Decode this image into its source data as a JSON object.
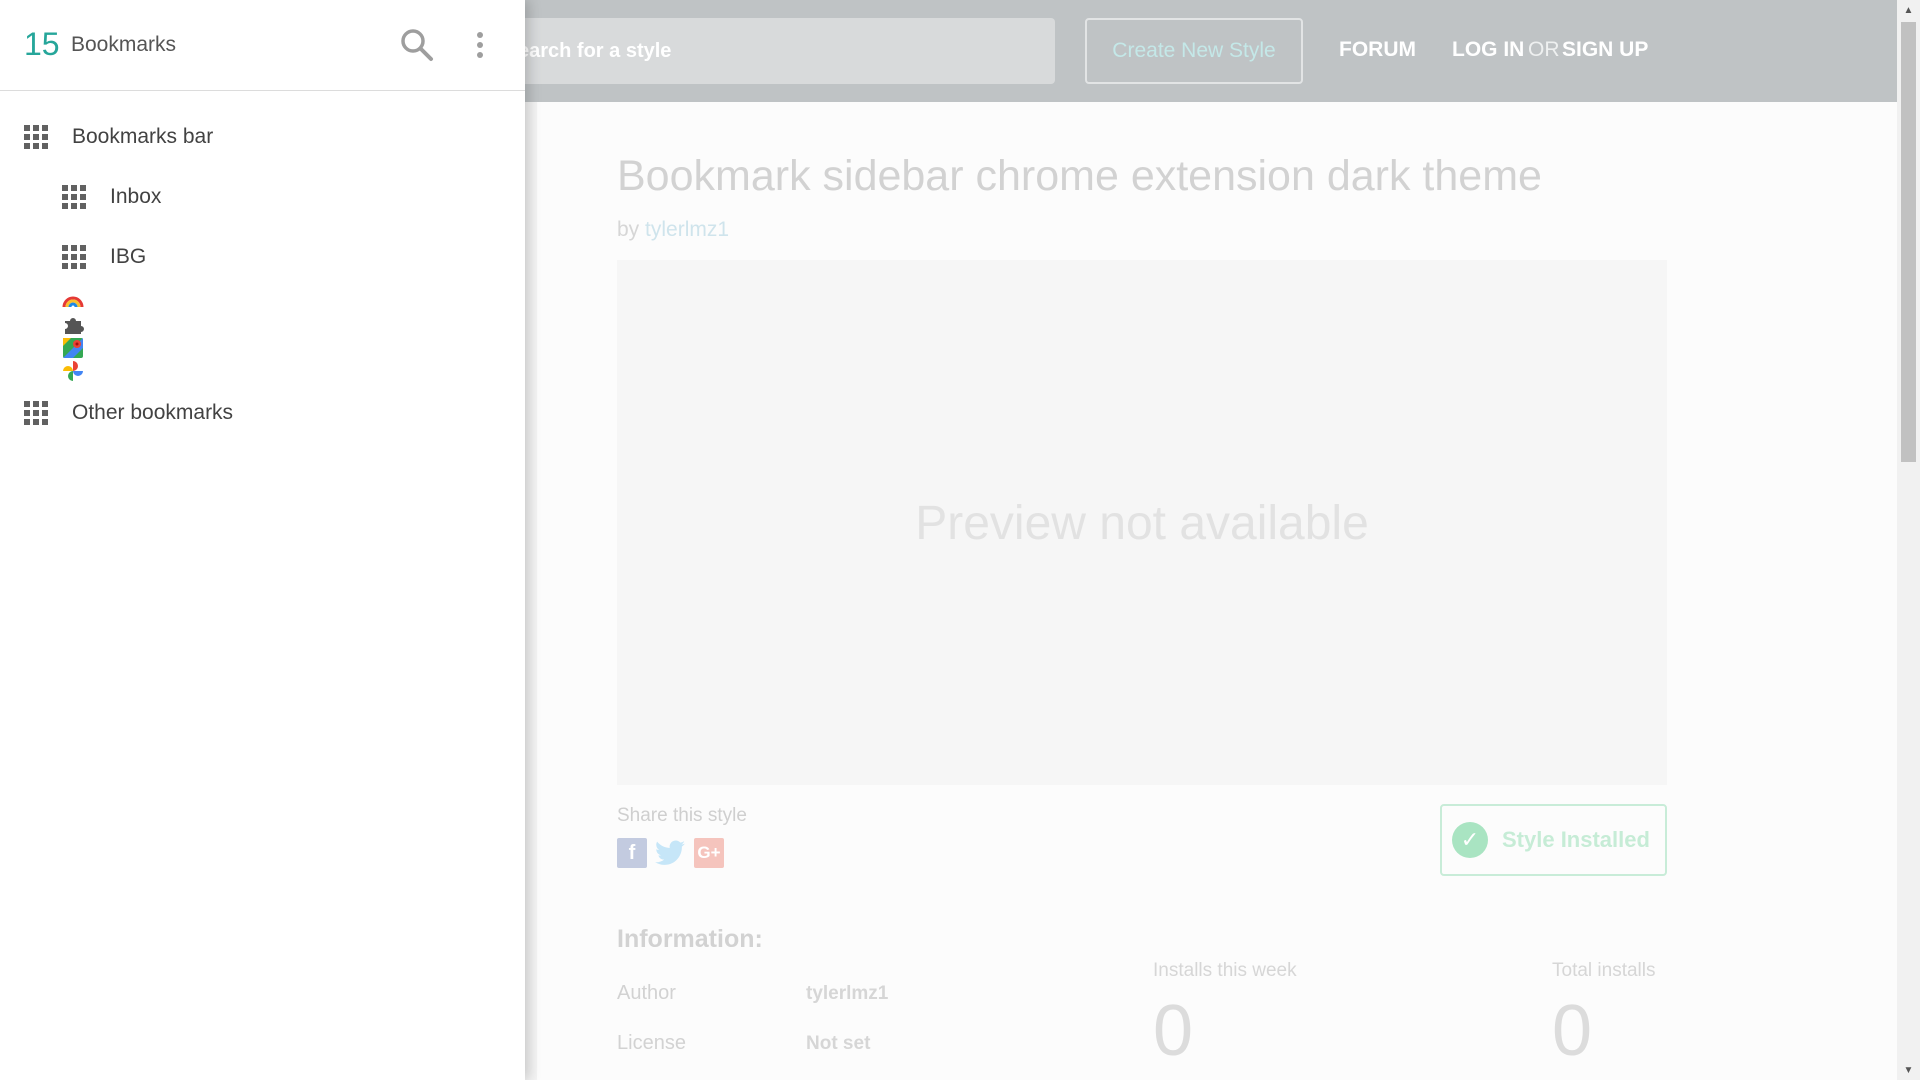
{
  "sidebar": {
    "count": "15",
    "title": "Bookmarks",
    "folders": {
      "bookmarks_bar": "Bookmarks bar",
      "inbox": "Inbox",
      "ibg": "IBG",
      "other": "Other bookmarks"
    },
    "favicons": [
      "rainbow-icon",
      "puzzle-piece-icon",
      "google-maps-icon",
      "google-photos-icon"
    ]
  },
  "site": {
    "search_placeholder": "earch for a style",
    "create_button": "Create New Style",
    "nav": {
      "forum": "FORUM",
      "login": "LOG IN",
      "or": "OR",
      "signup": "SIGN UP"
    }
  },
  "style": {
    "title": "Bookmark sidebar chrome extension dark theme",
    "by": "by",
    "author": "tylerlmz1",
    "preview_text": "Preview not available",
    "share_label": "Share this style",
    "installed_label": "Style Installed"
  },
  "info": {
    "heading": "Information:",
    "author_key": "Author",
    "author_value": "tylerlmz1",
    "license_key": "License",
    "license_value": "Not set",
    "installs_week_label": "Installs this week",
    "installs_week_value": "0",
    "total_installs_label": "Total installs",
    "total_installs_value": "0"
  },
  "colors": {
    "accent": "#26a69a",
    "facebook": "#c3cbe0",
    "twitter": "#c6e6f8",
    "google_plus": "#f5c4bd"
  }
}
